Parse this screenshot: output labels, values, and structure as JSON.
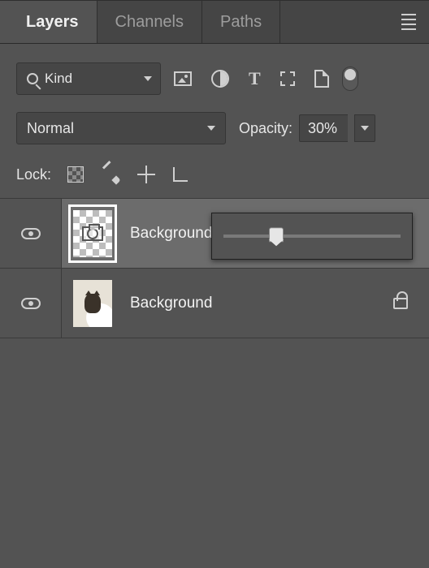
{
  "tabs": {
    "layers": "Layers",
    "channels": "Channels",
    "paths": "Paths"
  },
  "filter": {
    "kind_label": "Kind"
  },
  "blend": {
    "mode": "Normal"
  },
  "opacity": {
    "label": "Opacity:",
    "value": "30%",
    "slider_percent": 30
  },
  "lock": {
    "label": "Lock:"
  },
  "layers": [
    {
      "name": "Background copy",
      "selected": true,
      "locked": false,
      "thumb": "camera"
    },
    {
      "name": "Background",
      "selected": false,
      "locked": true,
      "thumb": "photo"
    }
  ]
}
